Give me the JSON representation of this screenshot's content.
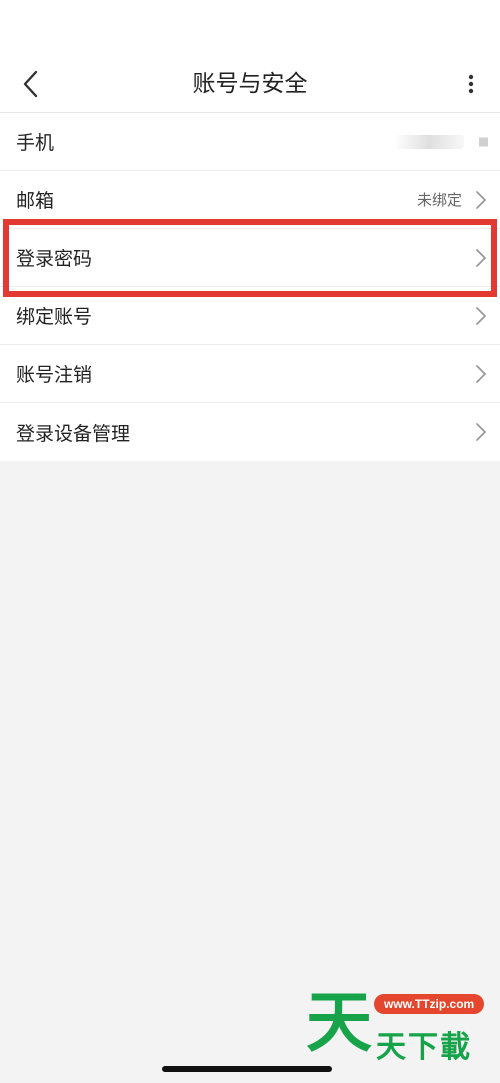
{
  "header": {
    "title": "账号与安全"
  },
  "rows": [
    {
      "label": "手机",
      "value": ""
    },
    {
      "label": "邮箱",
      "value": "未绑定"
    },
    {
      "label": "登录密码",
      "value": ""
    },
    {
      "label": "绑定账号",
      "value": ""
    },
    {
      "label": "账号注销",
      "value": ""
    },
    {
      "label": "登录设备管理",
      "value": ""
    }
  ],
  "watermark": {
    "big_char": "天",
    "url": "www.TTzip.com",
    "small_text": "天下載"
  },
  "colors": {
    "highlight": "#e23a33",
    "background": "#f3f3f3",
    "watermark_green": "#16a34a",
    "watermark_pill": "#e4472d"
  },
  "icons": {
    "back": "chevron-left-icon",
    "more": "more-vertical-icon",
    "row_arrow": "chevron-right-icon"
  }
}
